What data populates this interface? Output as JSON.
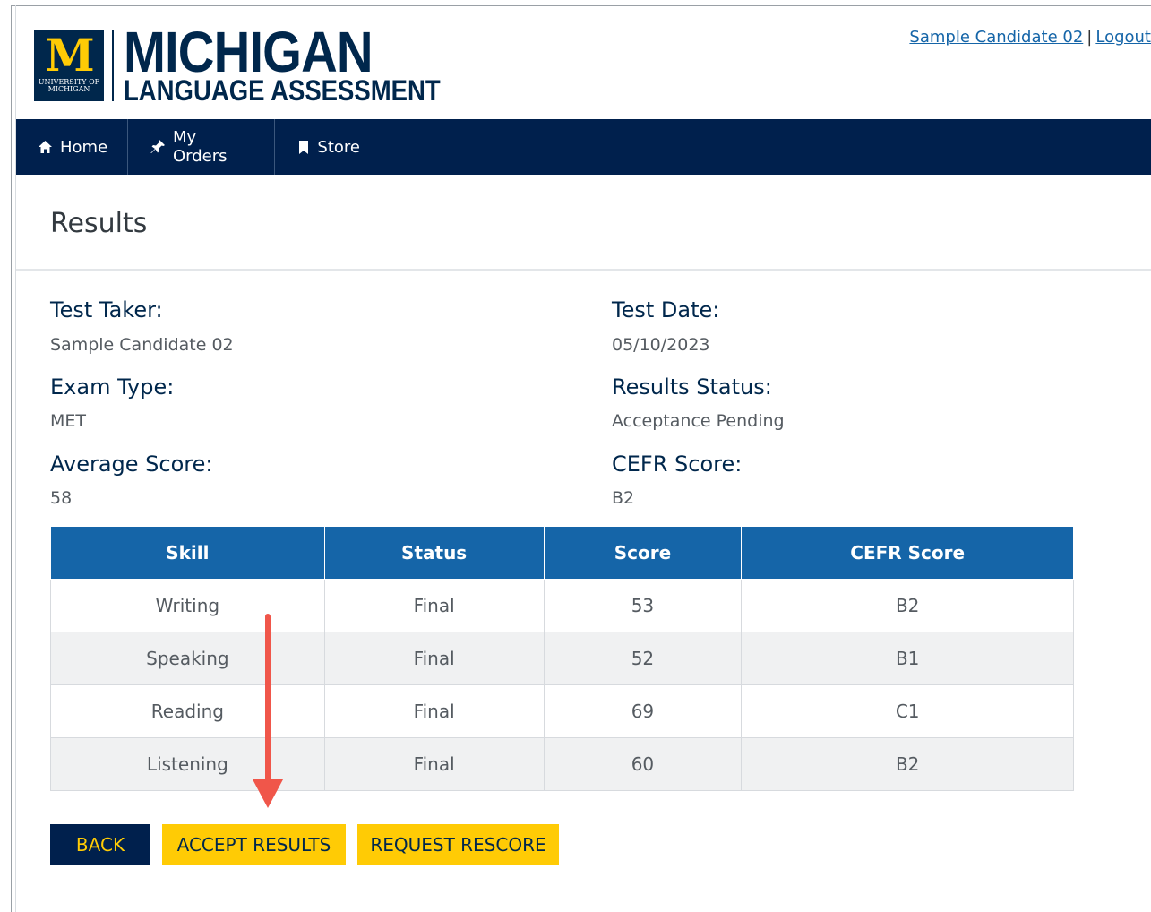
{
  "header": {
    "logo": {
      "mark": "M",
      "university_line1": "UNIVERSITY OF",
      "university_line2": "MICHIGAN",
      "title": "MICHIGAN",
      "subtitle": "LANGUAGE ASSESSMENT"
    },
    "user_link": "Sample Candidate 02",
    "separator": "|",
    "logout_link": "Logout"
  },
  "nav": {
    "items": [
      {
        "label": "Home",
        "icon": "home-icon"
      },
      {
        "label": "My Orders",
        "icon": "pin-icon"
      },
      {
        "label": "Store",
        "icon": "bookmark-icon"
      }
    ]
  },
  "page": {
    "title": "Results"
  },
  "info": {
    "test_taker_label": "Test Taker:",
    "test_taker_value": "Sample Candidate 02",
    "test_date_label": "Test Date:",
    "test_date_value": "05/10/2023",
    "exam_type_label": "Exam Type:",
    "exam_type_value": "MET",
    "results_status_label": "Results Status:",
    "results_status_value": "Acceptance Pending",
    "average_score_label": "Average Score:",
    "average_score_value": "58",
    "cefr_score_label": "CEFR Score:",
    "cefr_score_value": "B2"
  },
  "table": {
    "headers": [
      "Skill",
      "Status",
      "Score",
      "CEFR Score"
    ],
    "rows": [
      [
        "Writing",
        "Final",
        "53",
        "B2"
      ],
      [
        "Speaking",
        "Final",
        "52",
        "B1"
      ],
      [
        "Reading",
        "Final",
        "69",
        "C1"
      ],
      [
        "Listening",
        "Final",
        "60",
        "B2"
      ]
    ]
  },
  "buttons": {
    "back": "BACK",
    "accept": "ACCEPT RESULTS",
    "rescore": "REQUEST RESCORE"
  },
  "colors": {
    "navy": "#00274c",
    "nav_bg": "#00204d",
    "table_header": "#1565a8",
    "maize": "#ffcb05",
    "annotation_arrow": "#f0564a"
  }
}
